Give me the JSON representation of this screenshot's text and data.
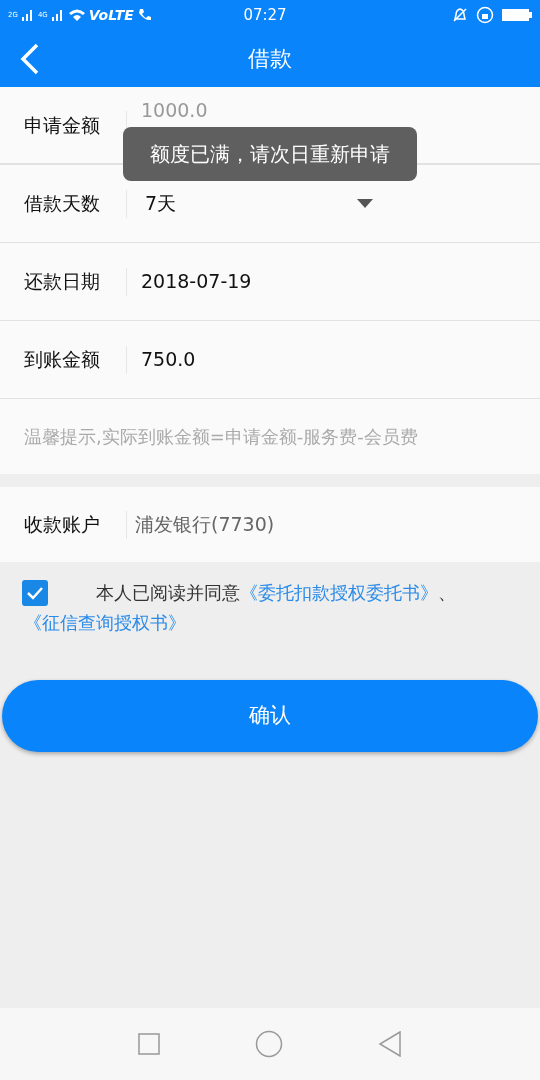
{
  "status_bar": {
    "network_1": "2G",
    "network_2": "4G",
    "volte": "VoLTE",
    "time": "07:27"
  },
  "header": {
    "title": "借款"
  },
  "form": [
    {
      "label": "申请金额",
      "placeholder": "1000.0",
      "kind": "input"
    },
    {
      "label": "借款天数",
      "value": "7天",
      "kind": "dropdown"
    },
    {
      "label": "还款日期",
      "value": "2018-07-19",
      "kind": "text"
    },
    {
      "label": "到账金额",
      "value": "750.0",
      "kind": "text"
    }
  ],
  "hint": "温馨提示,实际到账金额=申请金额-服务费-会员费",
  "account": {
    "label": "收款账户",
    "value": "浦发银行(7730)"
  },
  "agreement": {
    "checked": true,
    "text": "本人已阅读并同意",
    "link_1": "《委托扣款授权委托书》",
    "separator": "、",
    "link_2": "《征信查询授权书》"
  },
  "confirm_button": "确认",
  "toast": "额度已满，请次日重新申请"
}
